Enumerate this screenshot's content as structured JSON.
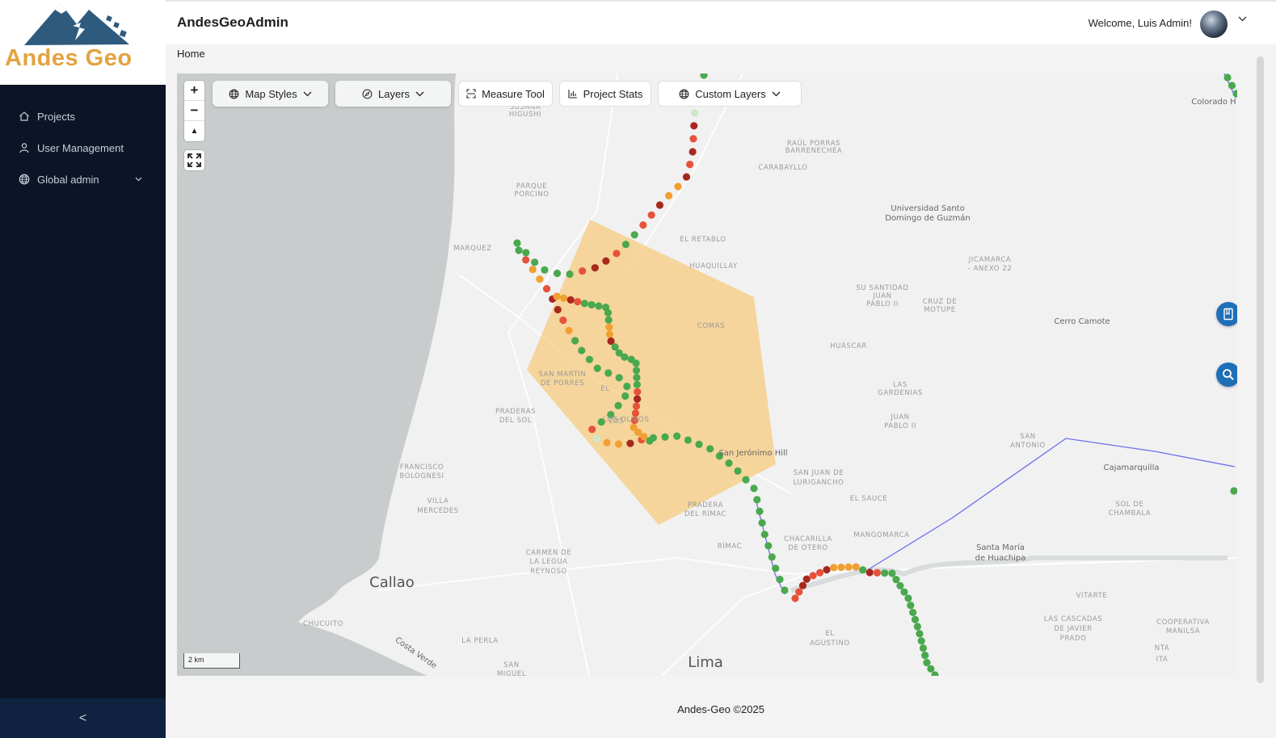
{
  "brand": {
    "logo_text": "Andes Geo"
  },
  "sidebar": {
    "items": [
      {
        "label": "Projects",
        "icon": "home-icon"
      },
      {
        "label": "User Management",
        "icon": "user-icon"
      },
      {
        "label": "Global admin",
        "icon": "globe-icon"
      }
    ],
    "collapse": "<"
  },
  "header": {
    "title": "AndesGeoAdmin",
    "welcome": "Welcome, Luis Admin!"
  },
  "breadcrumb": "Home",
  "toolbar": {
    "map_styles": "Map Styles",
    "layers": "Layers",
    "measure": "Measure Tool",
    "stats": "Project Stats",
    "custom_layers": "Custom Layers"
  },
  "map": {
    "zoom_in": "+",
    "zoom_out": "−",
    "scale": "2 km",
    "labels": [
      "SUSANA",
      "HIGUSHI",
      "RAÚL PORRAS",
      "BARRENECHEA",
      "CARABAYLLO",
      "PARQUE",
      "PORCINO",
      "Universidad Santo",
      "Domingo de Guzmán",
      "MARQUEZ",
      "EL RETABLO",
      "HUAQUILLAY",
      "JICAMARCA",
      "- ANEXO 22",
      "SU SANTIDAD",
      "JUAN",
      "PABLO II",
      "CRUZ DE",
      "MOTUPE",
      "Cerro Camote",
      "COMAS",
      "HUÁSCAR",
      "LAS",
      "GARDENIAS",
      "SAN MARTIN",
      "DE PORRES",
      "PRADERAS",
      "DEL SOL",
      "JUAN",
      "PABLO II",
      "LOS OLIVOS",
      "San Jerónimo Hill",
      "SAN",
      "ANTONIO",
      "Cajamarquilla",
      "FRANCISCO",
      "BOLOGNESI",
      "SAN JUAN DE",
      "LURIGANCHO",
      "EL SAUCE",
      "VILLA",
      "MERCEDES",
      "PRADERA",
      "DEL RÍMAC",
      "SOL DE",
      "CHAMBALA",
      "MANGOMARCA",
      "CHACARILLA",
      "DE OTERO",
      "RÍMAC",
      "Santa María",
      "de Huachipa",
      "CARMEN DE",
      "LA LEGUA",
      "REYNOSO",
      "VITARTE",
      "CHUCUITO",
      "LAS CASCADAS",
      "DE JAVIER",
      "PRADO",
      "COOPERATIVA",
      "MANILSA",
      "EL",
      "AGUSTINO",
      "LA PERLA",
      "Costa Verde",
      "SAN",
      "MIGUEL",
      "Colorado H",
      "NTA",
      "ITA",
      "EL",
      "LOS",
      "Callao",
      "Lima"
    ]
  },
  "colors": {
    "green": "#4aa84e",
    "red": "#e5533a",
    "darkred": "#a8281e",
    "orange": "#f0a030",
    "polygon": "#f7c978",
    "sidebar": "#0b1527",
    "accent": "#1f6fb8"
  },
  "footer": "Andes-Geo ©2025"
}
